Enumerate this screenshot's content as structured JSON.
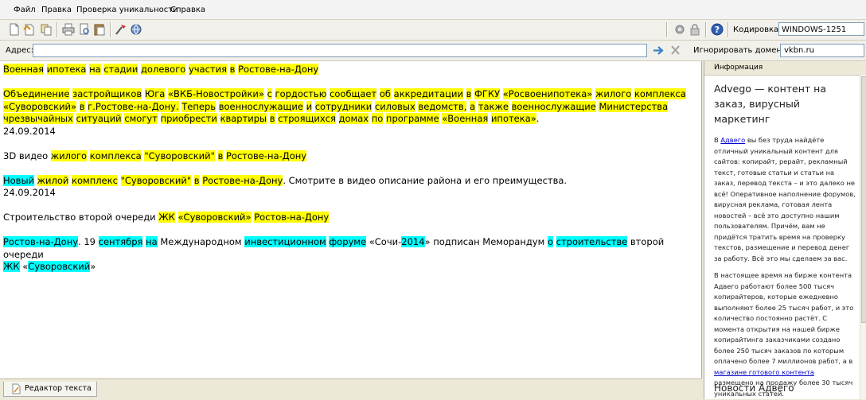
{
  "menu": [
    "Файл",
    "Правка",
    "Проверка уникальности",
    "Справка"
  ],
  "toolbar": {
    "encoding_label": "Кодировка:",
    "encoding_value": "WINDOWS-1251",
    "icons": [
      "new-document-icon",
      "open-document-icon",
      "copy-icon",
      "print-icon",
      "print-preview-icon",
      "paste-icon",
      "check-icon",
      "web-icon",
      "settings-icon",
      "lock-icon",
      "help-icon"
    ]
  },
  "address": {
    "label": "Адрес:",
    "value": "",
    "ignore_label": "Игнорировать домены:",
    "ignore_value": "vkbn.ru"
  },
  "document": [
    [
      [
        "Военная",
        "y"
      ],
      [
        " ",
        ""
      ],
      [
        "ипотека",
        "y"
      ],
      [
        " ",
        ""
      ],
      [
        "на",
        "y"
      ],
      [
        " ",
        ""
      ],
      [
        "стадии",
        "y"
      ],
      [
        " ",
        ""
      ],
      [
        "долевого",
        "y"
      ],
      [
        " ",
        ""
      ],
      [
        "участия",
        "y"
      ],
      [
        " ",
        ""
      ],
      [
        "в",
        "y"
      ],
      [
        " ",
        ""
      ],
      [
        "Ростове-на-Дону",
        "y"
      ]
    ],
    [],
    [
      [
        "Объединение",
        "y"
      ],
      [
        " ",
        ""
      ],
      [
        "застройщиков",
        "y"
      ],
      [
        " ",
        ""
      ],
      [
        "Юга",
        "y"
      ],
      [
        " ",
        ""
      ],
      [
        "«ВКБ-Новостройки»",
        "y"
      ],
      [
        " ",
        ""
      ],
      [
        "с",
        "y"
      ],
      [
        " ",
        ""
      ],
      [
        "гордостью",
        "y"
      ],
      [
        " ",
        ""
      ],
      [
        "сообщает",
        "y"
      ],
      [
        " ",
        ""
      ],
      [
        "об",
        "y"
      ],
      [
        " ",
        ""
      ],
      [
        "аккредитации",
        "y"
      ],
      [
        " ",
        ""
      ],
      [
        "в",
        "y"
      ],
      [
        " ",
        ""
      ],
      [
        "ФГКУ",
        "y"
      ],
      [
        " ",
        ""
      ],
      [
        "«Росвоенипотека»",
        "y"
      ],
      [
        " ",
        ""
      ],
      [
        "жилого",
        "y"
      ],
      [
        " ",
        ""
      ],
      [
        "комплекса",
        "y"
      ]
    ],
    [
      [
        "«Суворовский»",
        "y"
      ],
      [
        " ",
        ""
      ],
      [
        "в",
        "y"
      ],
      [
        " ",
        ""
      ],
      [
        "г.Ростове-на-Дону.",
        "y"
      ],
      [
        " ",
        ""
      ],
      [
        "Теперь",
        "y"
      ],
      [
        " ",
        ""
      ],
      [
        "военнослужащие",
        "y"
      ],
      [
        " ",
        ""
      ],
      [
        "и",
        "y"
      ],
      [
        " ",
        ""
      ],
      [
        "сотрудники",
        "y"
      ],
      [
        " ",
        ""
      ],
      [
        "силовых",
        "y"
      ],
      [
        " ",
        ""
      ],
      [
        "ведомств,",
        "y"
      ],
      [
        " ",
        ""
      ],
      [
        "а",
        "y"
      ],
      [
        " ",
        ""
      ],
      [
        "также",
        "y"
      ],
      [
        " ",
        ""
      ],
      [
        "военнослужащие",
        "y"
      ],
      [
        " ",
        ""
      ],
      [
        "Министерства",
        "y"
      ]
    ],
    [
      [
        "чрезвычайных",
        "y"
      ],
      [
        " ",
        ""
      ],
      [
        "ситуаций",
        "y"
      ],
      [
        " ",
        ""
      ],
      [
        "смогут",
        "y"
      ],
      [
        " ",
        ""
      ],
      [
        "приобрести",
        "y"
      ],
      [
        " ",
        ""
      ],
      [
        "квартиры",
        "y"
      ],
      [
        " ",
        ""
      ],
      [
        "в",
        "y"
      ],
      [
        " ",
        ""
      ],
      [
        "строящихся",
        "y"
      ],
      [
        " ",
        ""
      ],
      [
        "домах",
        "y"
      ],
      [
        " ",
        ""
      ],
      [
        "по",
        "y"
      ],
      [
        " ",
        ""
      ],
      [
        "программе",
        "y"
      ],
      [
        " ",
        ""
      ],
      [
        "«Военная",
        "y"
      ],
      [
        " ",
        ""
      ],
      [
        "ипотека»",
        "y"
      ],
      [
        ".",
        ""
      ]
    ],
    [
      [
        "24.09.2014",
        ""
      ]
    ],
    [],
    [
      [
        "3D видео ",
        ""
      ],
      [
        "жилого",
        "y"
      ],
      [
        " ",
        ""
      ],
      [
        "комплекса",
        "y"
      ],
      [
        " ",
        ""
      ],
      [
        "\"Суворовский\"",
        "y"
      ],
      [
        " ",
        ""
      ],
      [
        "в",
        "y"
      ],
      [
        " ",
        ""
      ],
      [
        "Ростове-на-Дону",
        "y"
      ]
    ],
    [],
    [
      [
        "Новый",
        "c"
      ],
      [
        " ",
        ""
      ],
      [
        "жилой",
        "y"
      ],
      [
        " ",
        ""
      ],
      [
        "комплекс",
        "y"
      ],
      [
        " ",
        ""
      ],
      [
        "\"Суворовский\"",
        "y"
      ],
      [
        " ",
        ""
      ],
      [
        "в",
        "y"
      ],
      [
        " ",
        ""
      ],
      [
        "Ростове-на-Дону",
        "y"
      ],
      [
        ". Смотрите в видео описание района и его преимущества.",
        ""
      ]
    ],
    [
      [
        "24.09.2014",
        ""
      ]
    ],
    [],
    [
      [
        "Строительство второй очереди ",
        ""
      ],
      [
        "ЖК",
        "y"
      ],
      [
        " ",
        ""
      ],
      [
        "«Суворовский»",
        "y"
      ],
      [
        " ",
        ""
      ],
      [
        "Ростов-на-Дону",
        "y"
      ]
    ],
    [],
    [
      [
        "Ростов-на-Дону",
        "c"
      ],
      [
        ". 19 ",
        ""
      ],
      [
        "сентября",
        "c"
      ],
      [
        " ",
        ""
      ],
      [
        "на",
        "c"
      ],
      [
        " Международном ",
        ""
      ],
      [
        "инвестиционном",
        "c"
      ],
      [
        " ",
        ""
      ],
      [
        "форуме",
        "c"
      ],
      [
        " «Сочи-",
        ""
      ],
      [
        "2014",
        "c"
      ],
      [
        "» подписан Меморандум ",
        ""
      ],
      [
        "о",
        "c"
      ],
      [
        " ",
        ""
      ],
      [
        "строительстве",
        "c"
      ],
      [
        " второй очереди",
        ""
      ]
    ],
    [
      [
        "ЖК",
        "c"
      ],
      [
        " «",
        ""
      ],
      [
        "Суворовский",
        "c"
      ],
      [
        "»",
        ""
      ]
    ]
  ],
  "info": {
    "header": "Информация",
    "title": "Advego — контент на заказ, вирусный маркетинг",
    "para1_a": "В ",
    "para1_link": "Адвего",
    "para1_b": " вы без труда найдёте отличный уникальный контент для сайтов: копирайт, рерайт, рекламный текст, готовые статьи и статьи на заказ, перевод текста – и это далеко не всё! Оперативное наполнение форумов, вирусная реклама, готовая лента новостей – всё это доступно нашим пользователям. Причём, вам не придётся тратить время на проверку текстов, размещение и перевод денег за работу. Всё это мы сделаем за вас.",
    "para2_a": "В настоящее время на бирже контента Адвего работают более 500 тысяч копирайтеров, которые ежедневно выполняют более 25 тысяч работ, и это количество постоянно растёт. С момента открытия на нашей бирже копирайтинга заказчиками создано более 250 тысяч заказов по которым оплачено более 7 миллионов работ, а в ",
    "para2_link": "магазине готового контента",
    "para2_b": " размещено на продажу более 30 тысяч уникальных статей.",
    "news_title": "Новости Адвего"
  },
  "bottom_tab": "Редактор текста"
}
